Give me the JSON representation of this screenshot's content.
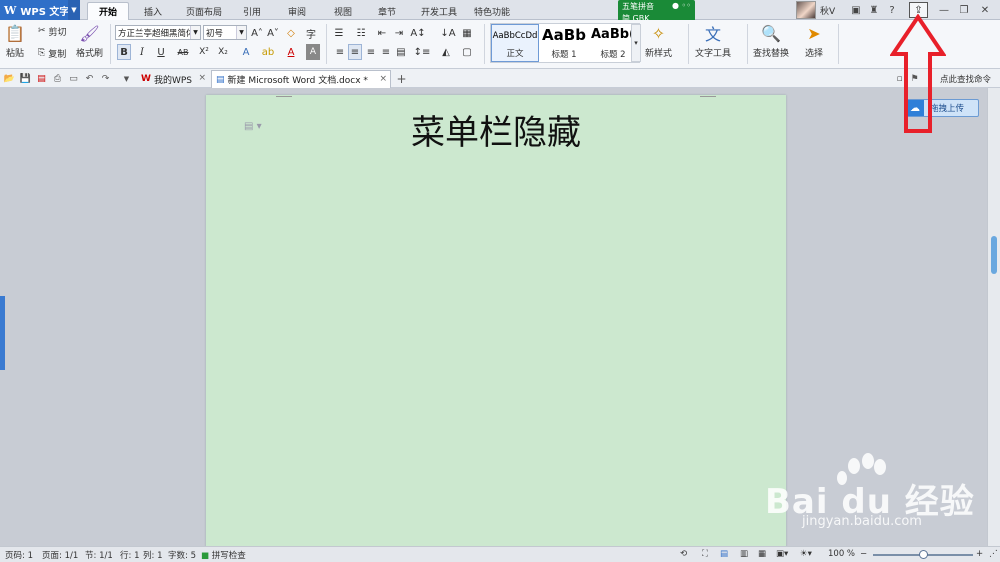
{
  "app": {
    "title": "WPS 文字"
  },
  "menu_tabs": [
    "开始",
    "插入",
    "页面布局",
    "引用",
    "审阅",
    "视图",
    "章节",
    "开发工具",
    "特色功能"
  ],
  "ime": {
    "name": "五笔拼音",
    "mode": "简 GBK"
  },
  "user": {
    "name": "秋V"
  },
  "ribbon": {
    "paste": "粘贴",
    "cut": "剪切",
    "copy": "复制",
    "format_painter": "格式刷",
    "font_name": "方正兰亭超细黑简体",
    "font_size": "初号",
    "styles": [
      {
        "preview": "AaBbCcDd",
        "label": "正文"
      },
      {
        "preview": "AaBb",
        "label": "标题 1"
      },
      {
        "preview": "AaBb(",
        "label": "标题 2"
      }
    ],
    "new_style": "新样式",
    "text_tools": "文字工具",
    "find_replace": "查找替换",
    "select": "选择"
  },
  "doc_tabs": [
    {
      "label": "我的WPS"
    },
    {
      "label": "新建 Microsoft Word 文档.docx *"
    }
  ],
  "find_command": "点此查找命令",
  "upload_button": "拖拽上传",
  "document": {
    "title": "菜单栏隐藏"
  },
  "status": {
    "page_number": "页码: 1",
    "pages": "页面: 1/1",
    "section": "节: 1/1",
    "row": "行: 1",
    "column": "列: 1",
    "word_count": "字数: 5",
    "spell_check": "拼写检查",
    "zoom": "100 %",
    "zoom_fraction": 0.5
  },
  "watermark": {
    "brand": "Bai du 经验",
    "url": "jingyan.baidu.com"
  },
  "colors": {
    "accent": "#2f6fc8",
    "page": "#cce8cf",
    "annotation": "#e8202a",
    "ime": "#1a8a37"
  }
}
